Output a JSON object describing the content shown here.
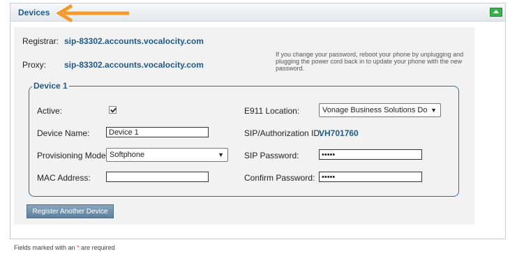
{
  "panel": {
    "title": "Devices"
  },
  "connection": {
    "registrar_label": "Registrar:",
    "registrar_value": "sip-83302.accounts.vocalocity.com",
    "proxy_label": "Proxy:",
    "proxy_value": "sip-83302.accounts.vocalocity.com",
    "note": "If you change your password, reboot your phone by unplugging and plugging the power cord back in to update your phone with the new password."
  },
  "device": {
    "legend": "Device 1",
    "active_label": "Active:",
    "active_checked": true,
    "device_name_label": "Device Name:",
    "device_name_value": "Device 1",
    "provisioning_label": "Provisioning Model:",
    "provisioning_value": "Softphone",
    "mac_label": "MAC Address:",
    "mac_value": "",
    "e911_label": "E911 Location:",
    "e911_value": "Vonage Business Solutions Do",
    "sip_id_label": "SIP/Authorization ID:",
    "sip_id_value": "VH701760",
    "sip_password_label": "SIP Password:",
    "sip_password_value": "•••••",
    "confirm_password_label": "Confirm Password:",
    "confirm_password_value": "•••••"
  },
  "actions": {
    "register_label": "Register Another Device"
  },
  "footer": {
    "text_before": "Fields marked with an",
    "asterisk": "*",
    "text_after": "are required"
  },
  "colors": {
    "accent": "#1d5a8a",
    "arrow": "#f39a2b",
    "collapse": "#37b24d"
  }
}
